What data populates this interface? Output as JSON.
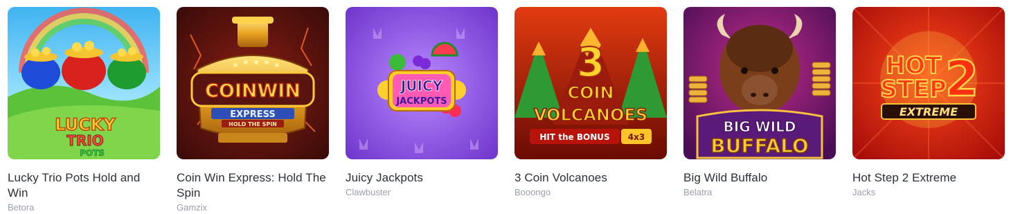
{
  "games": [
    {
      "title": "Lucky Trio Pots Hold and Win",
      "provider": "Betora",
      "art_text": [
        "LUCKY",
        "TRIO",
        "POTS"
      ]
    },
    {
      "title": "Coin Win Express: Hold The Spin",
      "provider": "Gamzix",
      "art_text": [
        "COINWIN",
        "EXPRESS",
        "HOLD THE SPIN"
      ]
    },
    {
      "title": "Juicy Jackpots",
      "provider": "Clawbuster",
      "art_text": [
        "JUICY",
        "JACKPOTS"
      ]
    },
    {
      "title": "3 Coin Volcanoes",
      "provider": "Booongo",
      "art_text": [
        "3",
        "COIN",
        "VOLCANOES",
        "HIT the BONUS",
        "4x3"
      ]
    },
    {
      "title": "Big Wild Buffalo",
      "provider": "Belatra",
      "art_text": [
        "BIG WILD",
        "BUFFALO"
      ]
    },
    {
      "title": "Hot Step 2 Extreme",
      "provider": "Jacks",
      "art_text": [
        "HOT",
        "STEP",
        "2",
        "EXTREME"
      ]
    }
  ]
}
